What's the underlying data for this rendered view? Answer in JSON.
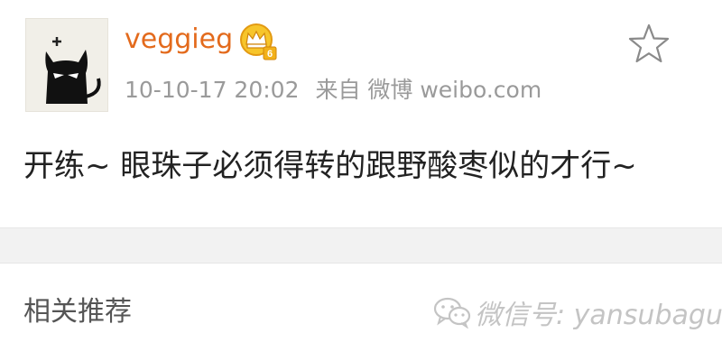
{
  "post": {
    "username": "veggieg",
    "avatar_icon": "black-cat-avatar-icon",
    "badge_icon": "crown-vip-badge-icon",
    "badge_level": "6",
    "date": "10-10-17 20:02",
    "source_label": "来自 微博 weibo.com",
    "text": "开练~ 眼珠子必须得转的跟野酸枣似的才行~",
    "star_icon": "star-outline-icon"
  },
  "related": {
    "title": "相关推荐"
  },
  "watermark": {
    "icon": "wechat-icon",
    "text": "微信号: yansubagua"
  },
  "colors": {
    "username": "#e36a1c",
    "meta": "#9a9a9a",
    "badge": "#f2b11a",
    "separator": "#f2f2f2"
  }
}
